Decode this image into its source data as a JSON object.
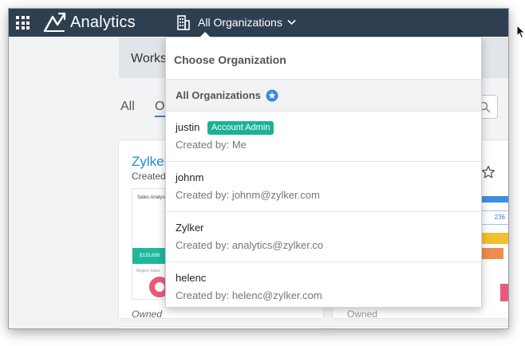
{
  "header": {
    "app_title": "Analytics",
    "org_switcher_label": "All Organizations",
    "colors": {
      "topbar": "#2f3f52",
      "accent": "#19b394",
      "link": "#1e8fd6"
    }
  },
  "workspace": {
    "title": "Works",
    "filters": {
      "all": "All",
      "other": "O"
    }
  },
  "cards": [
    {
      "name": "Zylker",
      "created": "Created",
      "thumbnail": {
        "header": "Sales Analysis Sa",
        "value": "$133,698",
        "small": "Region Sales"
      },
      "owned": "Owned"
    },
    {
      "value": "236",
      "owned": "Owned"
    }
  ],
  "dropdown": {
    "title": "Choose Organization",
    "all_label": "All Organizations",
    "all_icon": "star-badge-icon",
    "organizations": [
      {
        "name": "justin",
        "role": "Account Admin",
        "created_by": "Created by: Me"
      },
      {
        "name": "johnm",
        "role": "",
        "created_by": "Created by: johnm@zylker.com"
      },
      {
        "name": "Zylker",
        "role": "",
        "created_by": "Created by: analytics@zylker.co"
      },
      {
        "name": "helenc",
        "role": "",
        "created_by": "Created by: helenc@zylker.com"
      }
    ]
  }
}
